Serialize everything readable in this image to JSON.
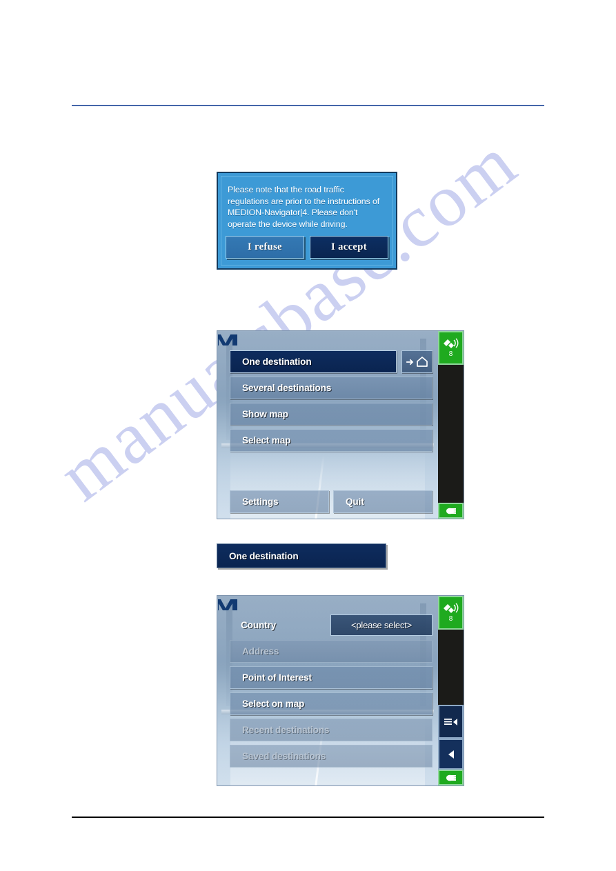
{
  "page": {
    "watermark": "manualsbase.com"
  },
  "figure_dialog": {
    "name": "disclaimer-dialog",
    "message": "Please note that the road traffic regulations are prior to the instructions of MEDION-Navigator|4. Please don't operate the device while driving.",
    "refuse_label": "I refuse",
    "accept_label": "I accept"
  },
  "figure_main_menu": {
    "logo": "medion-m-logo",
    "items": [
      {
        "label": "One destination",
        "state": "selected"
      },
      {
        "label": "Several destinations",
        "state": "normal"
      },
      {
        "label": "Show map",
        "state": "normal"
      },
      {
        "label": "Select map",
        "state": "normal"
      }
    ],
    "home_button": {
      "arrow": "→",
      "house": "⌂",
      "name": "go-home-button"
    },
    "bottom_items": [
      {
        "label": "Settings"
      },
      {
        "label": "Quit"
      }
    ],
    "sidebar": {
      "gps_icon": "gps-satellite-icon",
      "gps_count": "8",
      "power_icon": "power-hand-icon"
    }
  },
  "figure_standalone_button": {
    "label": "One destination"
  },
  "figure_destination_menu": {
    "logo": "medion-m-logo",
    "country_label": "Country",
    "country_value": "<please select>",
    "items": [
      {
        "label": "Address",
        "state": "disabled"
      },
      {
        "label": "Point of Interest",
        "state": "normal"
      },
      {
        "label": "Select on map",
        "state": "normal"
      },
      {
        "label": "Recent destinations",
        "state": "disabled"
      },
      {
        "label": "Saved destinations",
        "state": "disabled"
      }
    ],
    "sidebar": {
      "gps_icon": "gps-satellite-icon",
      "gps_count": "8",
      "menu_icon": "menu-list-icon",
      "back_icon": "back-arrow-icon",
      "power_icon": "power-hand-icon"
    }
  }
}
